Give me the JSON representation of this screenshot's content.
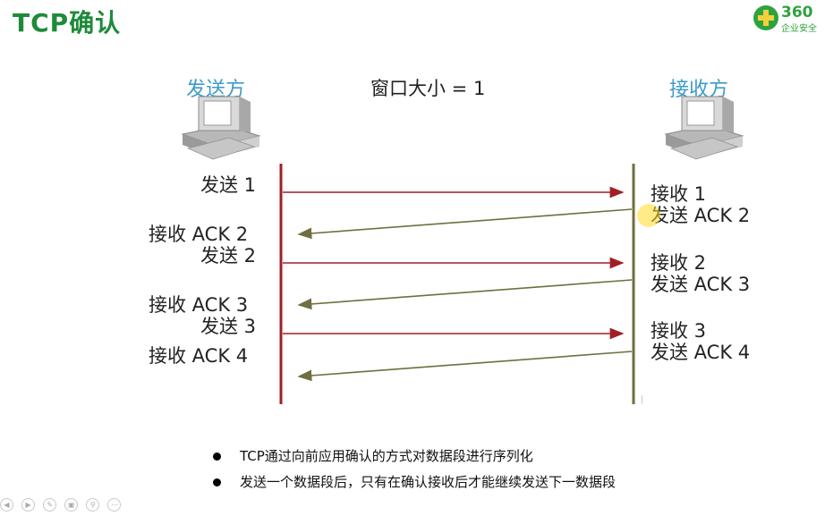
{
  "title": "TCP确认",
  "logo": {
    "number": "360",
    "subtitle": "企业安全"
  },
  "sender": {
    "label": "发送方"
  },
  "receiver": {
    "label": "接收方"
  },
  "window_size": "窗口大小 = 1",
  "sender_events": [
    "发送 1",
    "接收 ACK 2",
    "发送 2",
    "接收 ACK 3",
    "发送 3",
    "接收 ACK 4"
  ],
  "receiver_events": [
    "接收 1",
    "发送 ACK 2",
    "接收 2",
    "发送 ACK 3",
    "接收 3",
    "发送 ACK 4"
  ],
  "bullets": [
    "TCP通过向前应用确认的方式对数据段进行序列化",
    "发送一个数据段后，只有在确认接收后才能继续发送下一数据段"
  ],
  "colors": {
    "title": "#1f8a3a",
    "party": "#3d9bc7",
    "data_arrow": "#a11f24",
    "ack_arrow": "#6f6f40"
  },
  "icons": [
    "computer-icon",
    "computer-icon"
  ],
  "controls": [
    "prev-icon",
    "next-icon",
    "pen-icon",
    "screen-icon",
    "zoom-icon",
    "more-icon"
  ]
}
